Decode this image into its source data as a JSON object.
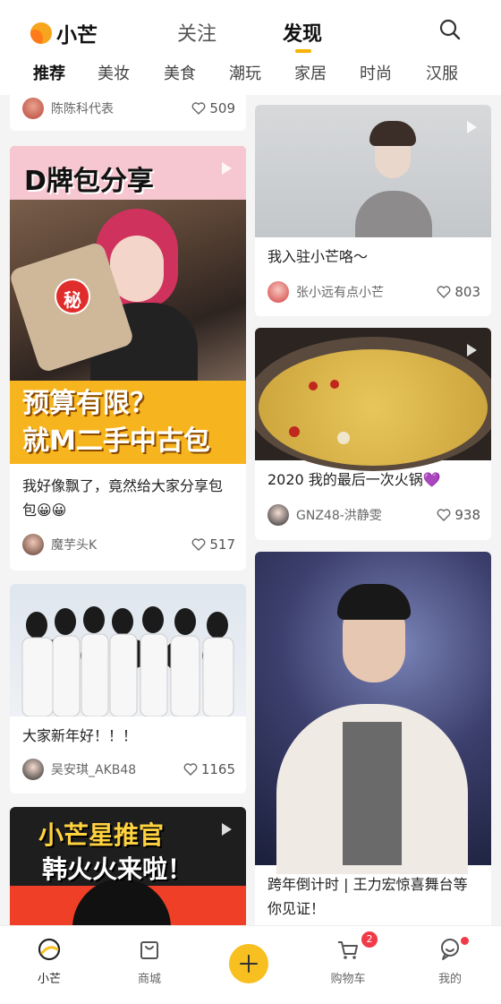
{
  "header": {
    "logo": "小芒",
    "tabs": [
      {
        "label": "关注"
      },
      {
        "label": "发现"
      }
    ],
    "categories": [
      "推荐",
      "美妆",
      "美食",
      "潮玩",
      "家居",
      "时尚",
      "汉服"
    ]
  },
  "feed": {
    "left": [
      {
        "author": "陈陈科代表",
        "likes": "509"
      },
      {
        "overlay_top": "D牌包分享",
        "overlay_seal": "秘",
        "overlay_bottom_1": "预算有限？",
        "overlay_bottom_2": "就M二手中古包",
        "title": "我好像飘了，竟然给大家分享包包😀😀",
        "author": "魔芋头K",
        "likes": "517"
      },
      {
        "title": "大家新年好！！！",
        "author": "吴安琪_AKB48",
        "likes": "1165"
      },
      {
        "overlay_1": "小芒星推官",
        "overlay_2": "韩火火来啦！"
      }
    ],
    "right": [
      {
        "title": "我入驻小芒咯～",
        "author": "张小远有点小芒",
        "likes": "803"
      },
      {
        "title": "2020 我的最后一次火锅💜",
        "author": "GNZ48-洪静雯",
        "likes": "938"
      },
      {
        "title": "跨年倒计时 | 王力宏惊喜舞台等你见证！"
      }
    ]
  },
  "bottom_nav": [
    {
      "label": "小芒"
    },
    {
      "label": "商城"
    },
    {
      "label": "购物车"
    },
    {
      "label": "我的"
    }
  ],
  "cart_badge": "2",
  "colors": {
    "accent": "#f8bf21",
    "badge": "#f03a48"
  }
}
